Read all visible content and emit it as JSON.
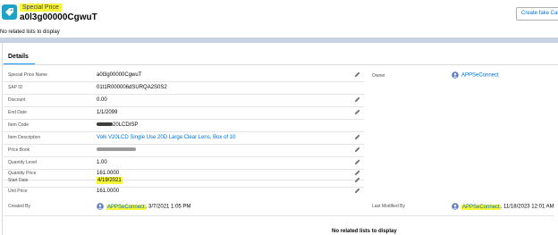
{
  "header": {
    "object_type": "Special Price",
    "record_title": "a0l3g00000CgwuT",
    "create_button_label": "Create fake Cas",
    "icon": "special-price-icon"
  },
  "related_top": "No related lists to display",
  "details": {
    "tab_label": "Details",
    "fields": [
      {
        "label": "Special Price Name",
        "value": "a0l3g00000CgwuT",
        "editable": true
      },
      {
        "label": "SAP ID",
        "value": "01t1R000006dSURQA2S0S2",
        "editable": false
      },
      {
        "label": "Discount",
        "value": "0.00",
        "editable": true
      },
      {
        "label": "End Date",
        "value": "1/1/2099",
        "editable": true
      },
      {
        "label": "Item Code",
        "value": "20LCDISP",
        "editable": false
      },
      {
        "label": "Item Description",
        "value": "Volk V20LCD Single Use 20D Large Clear Lens, Box of 10",
        "editable": true
      },
      {
        "label": "Price Book",
        "value": "",
        "editable": true
      },
      {
        "label": "Quantity Level",
        "value": "1.00",
        "editable": true
      },
      {
        "label": "Quantity Price",
        "value": "161.0000",
        "editable": true
      },
      {
        "label": "Start Date",
        "value": "4/19/2021",
        "editable": true
      },
      {
        "label": "Unit Price",
        "value": "161.0000",
        "editable": true
      }
    ],
    "owner": {
      "label": "Owner",
      "value": "APPSeConnect"
    },
    "created_by": {
      "label": "Created By",
      "user": "APPSeConnect",
      "date": ", 3/7/2021 1:05 PM"
    },
    "last_modified_by": {
      "label": "Last Modified By",
      "user": "APPSeConnect",
      "date": ", 11/18/2023 12:01 AM"
    }
  },
  "related_bottom": "No related lists to display",
  "colors": {
    "highlight": "#f7f63b",
    "link": "#0070d2",
    "object_icon": "#1fa1c8",
    "tab_underline": "#1b96ff"
  }
}
